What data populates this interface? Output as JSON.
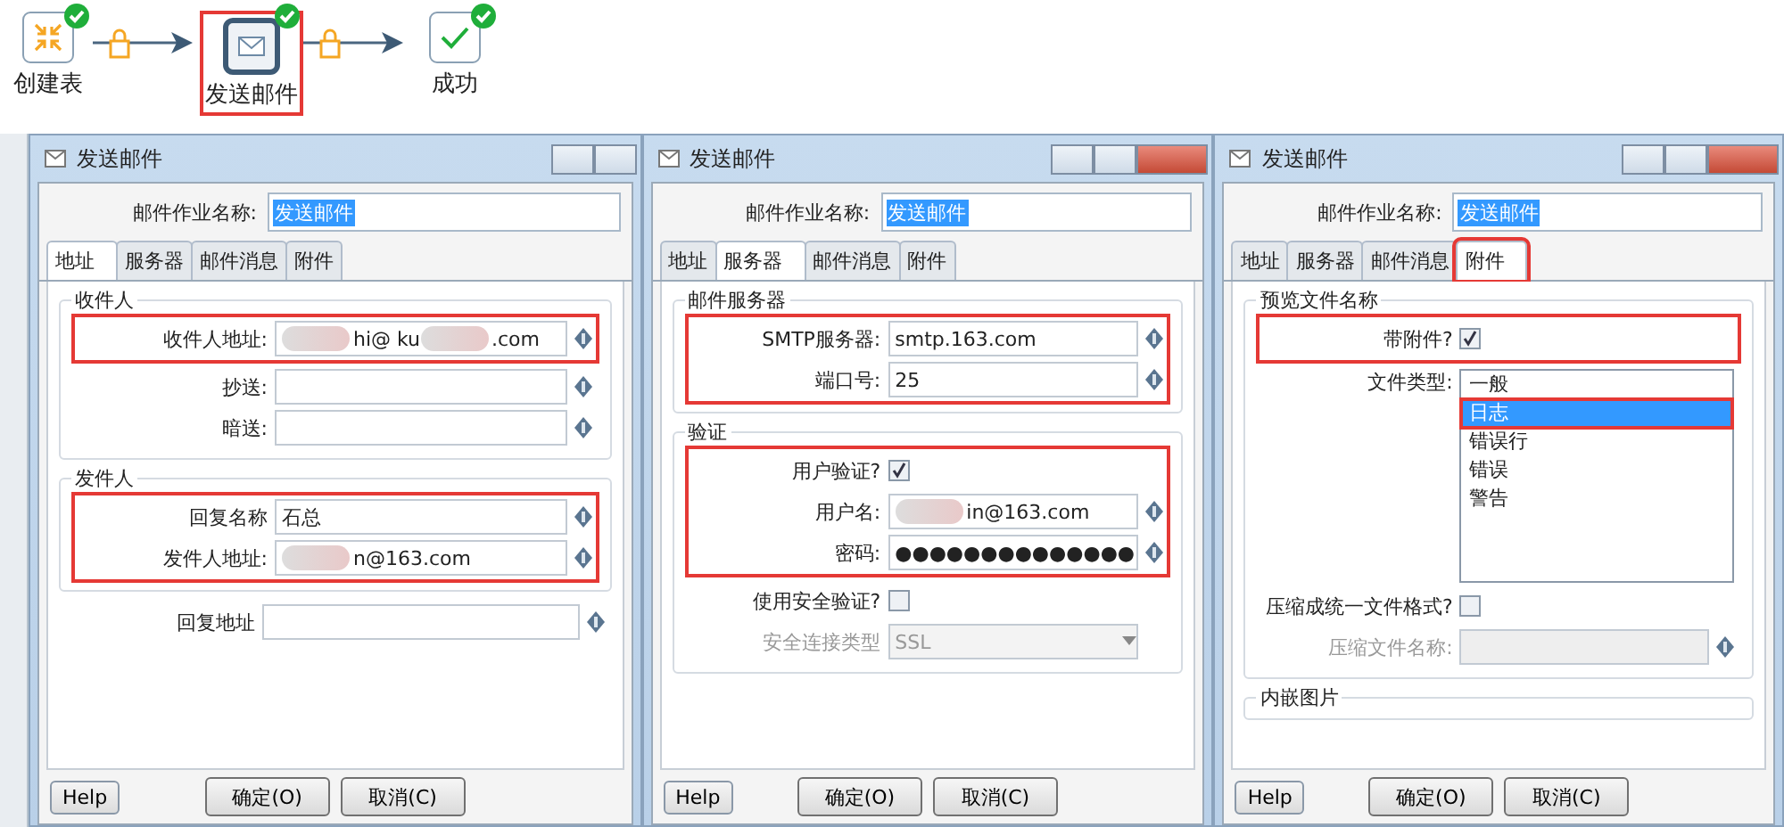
{
  "workflow": {
    "nodes": [
      {
        "kind": "table",
        "label": "创建表",
        "selected": false
      },
      {
        "kind": "mail",
        "label": "发送邮件",
        "selected": true
      },
      {
        "kind": "success",
        "label": "成功",
        "selected": false
      }
    ]
  },
  "dialogs": [
    {
      "title": "发送邮件",
      "job_label": "邮件作业名称:",
      "job_value": "发送邮件",
      "tabs": [
        {
          "label": "地址",
          "selected": true,
          "highlighted": false
        },
        {
          "label": "服务器",
          "selected": false,
          "highlighted": false
        },
        {
          "label": "邮件消息",
          "selected": false,
          "highlighted": false
        },
        {
          "label": "附件",
          "selected": false,
          "highlighted": false
        }
      ],
      "sections": [
        {
          "title": "收件人",
          "blocks": [
            {
              "highlighted": true,
              "rows": [
                {
                  "kind": "field",
                  "label": "收件人地址:",
                  "value": [
                    "hi@ ku",
                    ".com"
                  ],
                  "redacted": true
                }
              ]
            },
            {
              "highlighted": false,
              "rows": [
                {
                  "kind": "field",
                  "label": "抄送:"
                },
                {
                  "kind": "field",
                  "label": "暗送:"
                }
              ]
            }
          ]
        },
        {
          "title": "发件人",
          "blocks": [
            {
              "highlighted": true,
              "rows": [
                {
                  "kind": "field",
                  "label": "回复名称",
                  "value": [
                    "石总"
                  ],
                  "redacted": false
                },
                {
                  "kind": "field",
                  "label": "发件人地址:",
                  "value": [
                    "n@163.com"
                  ],
                  "redacted": true
                }
              ]
            }
          ]
        }
      ],
      "rows": [
        {
          "kind": "field",
          "label": "回复地址"
        }
      ],
      "buttons": [
        "确定(O)",
        "取消(C)"
      ],
      "help": "Help"
    },
    {
      "title": "发送邮件",
      "job_label": "邮件作业名称:",
      "job_value": "发送邮件",
      "tabs": [
        {
          "label": "地址",
          "selected": false,
          "highlighted": false
        },
        {
          "label": "服务器",
          "selected": true,
          "highlighted": false
        },
        {
          "label": "邮件消息",
          "selected": false,
          "highlighted": false
        },
        {
          "label": "附件",
          "selected": false,
          "highlighted": false
        }
      ],
      "sections": [
        {
          "title": "邮件服务器",
          "blocks": [
            {
              "highlighted": true,
              "rows": [
                {
                  "kind": "field",
                  "label": "SMTP服务器:",
                  "value": [
                    "smtp.163.com"
                  ],
                  "redacted": false
                },
                {
                  "kind": "field",
                  "label": "端口号:",
                  "value": [
                    "25"
                  ],
                  "redacted": false
                }
              ]
            }
          ]
        },
        {
          "title": "验证",
          "blocks": [
            {
              "highlighted": true,
              "rows": [
                {
                  "kind": "checkbox",
                  "label": "用户验证?",
                  "checked": true,
                  "disabled": false
                },
                {
                  "kind": "field",
                  "label": "用户名:",
                  "value": [
                    "in@163.com"
                  ],
                  "redacted": true
                },
                {
                  "kind": "field",
                  "label": "密码:",
                  "value": [
                    "●●●●●●●●●●●●●●"
                  ],
                  "redacted": false
                }
              ]
            },
            {
              "highlighted": false,
              "rows": [
                {
                  "kind": "checkbox",
                  "label": "使用安全验证?",
                  "checked": false,
                  "disabled": false
                },
                {
                  "kind": "combo",
                  "label": "安全连接类型",
                  "value": "SSL",
                  "disabled": true
                }
              ]
            }
          ]
        }
      ],
      "buttons": [
        "确定(O)",
        "取消(C)"
      ],
      "help": "Help"
    },
    {
      "title": "发送邮件",
      "job_label": "邮件作业名称:",
      "job_value": "发送邮件",
      "tabs": [
        {
          "label": "地址",
          "selected": false,
          "highlighted": false
        },
        {
          "label": "服务器",
          "selected": false,
          "highlighted": false
        },
        {
          "label": "邮件消息",
          "selected": false,
          "highlighted": false
        },
        {
          "label": "附件",
          "selected": true,
          "highlighted": true
        }
      ],
      "sections": [
        {
          "title": "预览文件名称",
          "blocks": [
            {
              "highlighted": true,
              "rows": [
                {
                  "kind": "checkbox",
                  "label": "带附件?",
                  "checked": true,
                  "disabled": false
                }
              ]
            },
            {
              "highlighted": false,
              "rows": [
                {
                  "kind": "list",
                  "label": "文件类型:",
                  "items": [
                    {
                      "label": "一般",
                      "selected": false,
                      "highlighted": false
                    },
                    {
                      "label": "日志",
                      "selected": true,
                      "highlighted": true
                    },
                    {
                      "label": "错误行",
                      "selected": false,
                      "highlighted": false
                    },
                    {
                      "label": "错误",
                      "selected": false,
                      "highlighted": false
                    },
                    {
                      "label": "警告",
                      "selected": false,
                      "highlighted": false
                    }
                  ]
                },
                {
                  "kind": "checkbox",
                  "label": "压缩成统一文件格式?",
                  "checked": false,
                  "disabled": false
                },
                {
                  "kind": "field",
                  "label": "压缩文件名称:",
                  "disabled": true
                }
              ]
            }
          ]
        },
        {
          "title": "内嵌图片"
        }
      ],
      "buttons": [
        "确定(O)",
        "取消(C)"
      ],
      "help": "Help"
    }
  ]
}
